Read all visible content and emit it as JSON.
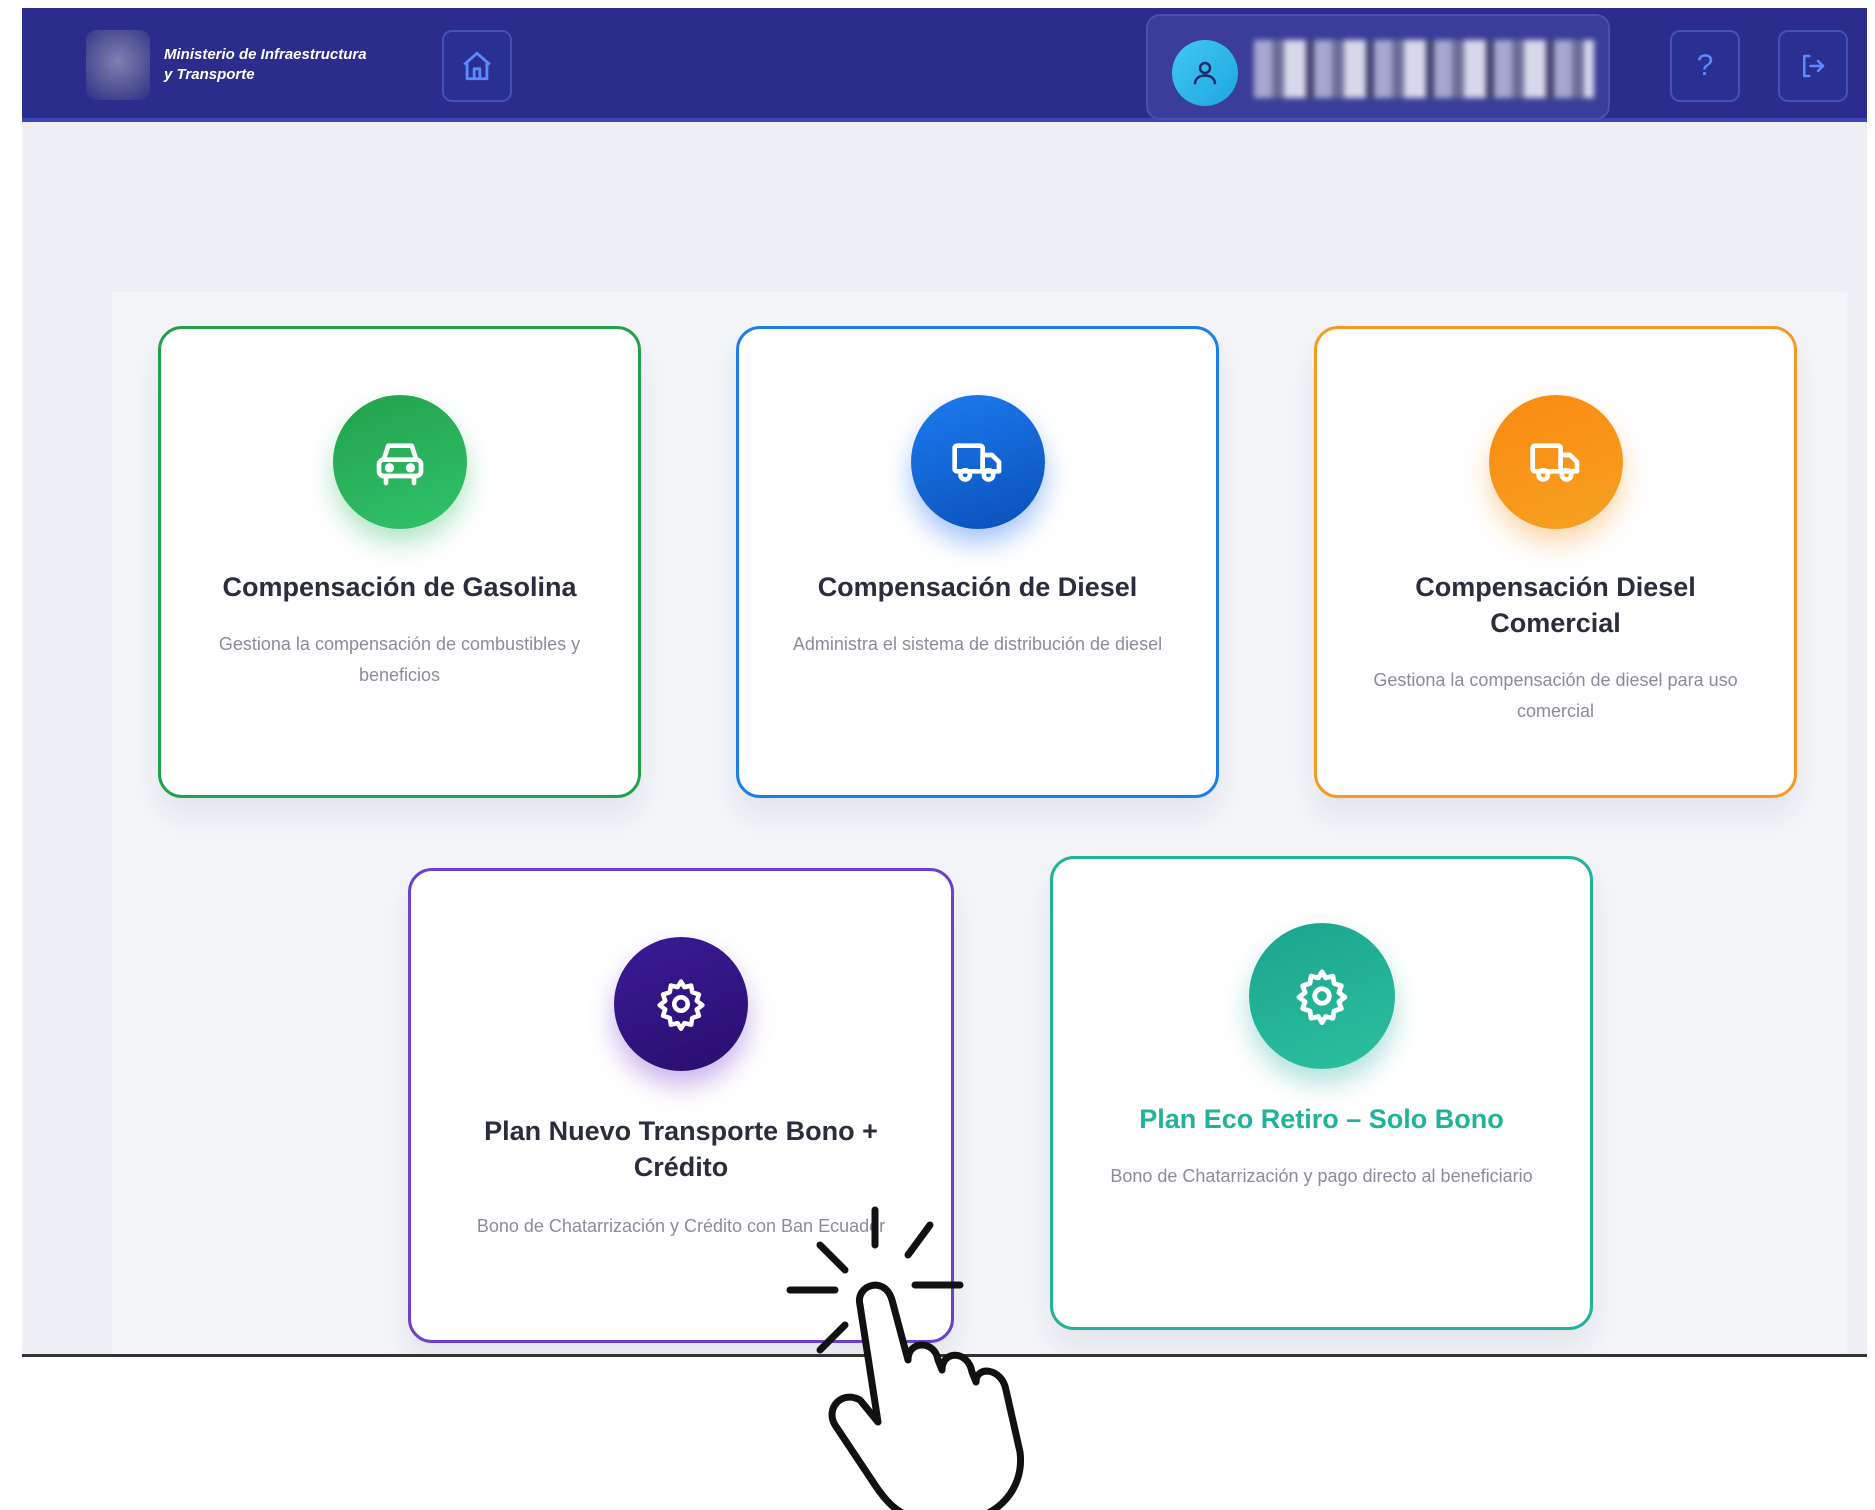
{
  "header": {
    "logo_text_line1": "Ministerio de Infraestructura",
    "logo_text_line2": "y Transporte",
    "home_icon": "home-icon",
    "user_icon": "user-icon",
    "help_label": "?",
    "logout_icon": "logout-icon"
  },
  "cards": [
    {
      "title": "Compensación de Gasolina",
      "description": "Gestiona la compensación de combustibles y beneficios",
      "icon": "car-icon",
      "color": "#22a14d"
    },
    {
      "title": "Compensación de Diesel",
      "description": "Administra el sistema de distribución de diesel",
      "icon": "truck-icon",
      "color": "#1a7fe8"
    },
    {
      "title": "Compensación Diesel Comercial",
      "description": "Gestiona la compensación de diesel para uso comercial",
      "icon": "truck-icon",
      "color": "#f59b23"
    },
    {
      "title": "Plan Nuevo Transporte Bono + Crédito",
      "description": "Bono de Chatarrización y Crédito con Ban Ecuador",
      "icon": "gear-icon",
      "color": "#6b3fd4"
    },
    {
      "title": "Plan Eco Retiro – Solo Bono",
      "description": "Bono de Chatarrización y pago directo al beneficiario",
      "icon": "gear-icon",
      "color": "#21b39a"
    }
  ]
}
